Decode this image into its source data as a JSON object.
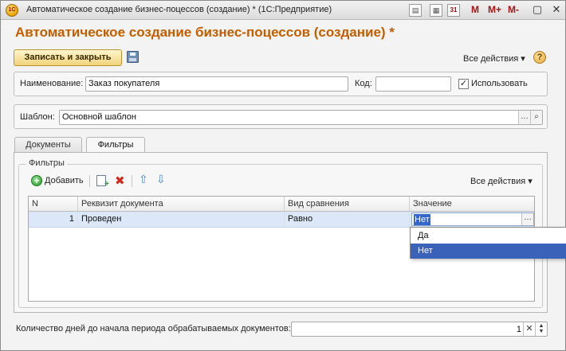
{
  "window": {
    "title": "Автоматическое создание бизнес-пoцессов (создание) *  (1С:Предприятие)",
    "app_icon_text": "1С",
    "toolbar_icons": [
      "file-icon",
      "calculator-icon",
      "calendar-icon"
    ],
    "calendar_text": "31",
    "memory_buttons": [
      "M",
      "M+",
      "M-"
    ],
    "controls": {
      "minimize": "▢",
      "close": "✕"
    }
  },
  "form": {
    "title": "Автоматическое создание бизнес-пoцессов (создание) *",
    "save_close_label": "Записать и закрыть",
    "all_actions_label": "Все действия",
    "help_label": "?"
  },
  "fields": {
    "name_label": "Наименование:",
    "name_value": "Заказ покупателя",
    "code_label": "Код:",
    "code_value": "",
    "use_label": "Использовать",
    "use_checked": true,
    "template_label": "Шаблон:",
    "template_value": "Основной шаблон"
  },
  "tabs": [
    {
      "label": "Документы",
      "active": false
    },
    {
      "label": "Фильтры",
      "active": true
    }
  ],
  "filters": {
    "legend": "Фильтры",
    "add_label": "Добавить",
    "all_actions_label": "Все действия",
    "columns": [
      "N",
      "Реквизит документа",
      "Вид сравнения",
      "Значение"
    ],
    "rows": [
      {
        "n": "1",
        "attribute": "Проведен",
        "comparison": "Равно",
        "value": "Нет"
      }
    ],
    "dropdown_options": [
      {
        "label": "Да",
        "selected": false
      },
      {
        "label": "Нет",
        "selected": true
      }
    ]
  },
  "bottom": {
    "days_label": "Количество дней до начала периода обрабатываемых документов:",
    "days_value": "1"
  }
}
